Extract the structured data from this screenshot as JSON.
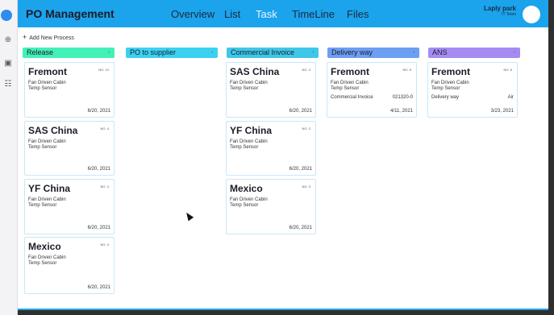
{
  "header": {
    "title": "PO Management",
    "nav": [
      "Overview",
      "List",
      "Task",
      "TimeLine",
      "Files"
    ],
    "active_nav": "Task",
    "user_name": "Laply park",
    "user_team": "IT Team"
  },
  "board": {
    "add_label": "Add New Process"
  },
  "columns": [
    {
      "title": "Release",
      "color": "#43f0b8",
      "cards": [
        {
          "name": "Fremont",
          "no": "NO. 10",
          "items": [
            "Fan Driven Cabin",
            "Temp Sensor"
          ],
          "date": "6/20, 2021"
        },
        {
          "name": "SAS China",
          "no": "NO. 4",
          "items": [
            "Fan Driven Cabin",
            "Temp Sensor"
          ],
          "date": "6/20, 2021"
        },
        {
          "name": "YF China",
          "no": "NO. 4",
          "items": [
            "Fan Driven Cabin",
            "Temp Sensor"
          ],
          "date": "6/20, 2021"
        },
        {
          "name": "Mexico",
          "no": "NO. 4",
          "items": [
            "Fan Driven Cabin",
            "Temp Sensor"
          ],
          "date": "6/20, 2021"
        }
      ]
    },
    {
      "title": "PO to supplier",
      "color": "#3bd2f2",
      "cards": []
    },
    {
      "title": "Commercial Invoice",
      "color": "#3ec7e9",
      "cards": [
        {
          "name": "SAS China",
          "no": "NO. 3",
          "items": [
            "Fan Driven Cabin",
            "Temp Sensor"
          ],
          "date": "6/20, 2021"
        },
        {
          "name": "YF China",
          "no": "NO. 3",
          "items": [
            "Fan Driven Cabin",
            "Temp Sensor"
          ],
          "date": "6/20, 2021"
        },
        {
          "name": "Mexico",
          "no": "NO. 3",
          "items": [
            "Fan Driven Cabin",
            "Temp Sensor"
          ],
          "date": "6/20, 2021"
        }
      ]
    },
    {
      "title": "Delivery way",
      "color": "#6c9ef3",
      "cards": [
        {
          "name": "Fremont",
          "no": "NO. 5",
          "items": [
            "Fan Driven Cabin",
            "Temp Sensor"
          ],
          "field_label": "Commercial Invoice",
          "field_value": "021320-0",
          "date": "4/11, 2021"
        }
      ]
    },
    {
      "title": "ANS",
      "color": "#a58cf3",
      "cards": [
        {
          "name": "Fremont",
          "no": "NO. 6",
          "items": [
            "Fan Driven Cabin",
            "Temp Sensor"
          ],
          "field_label": "Delivery way",
          "field_value": "Air",
          "date": "3/23, 2021"
        }
      ]
    }
  ]
}
